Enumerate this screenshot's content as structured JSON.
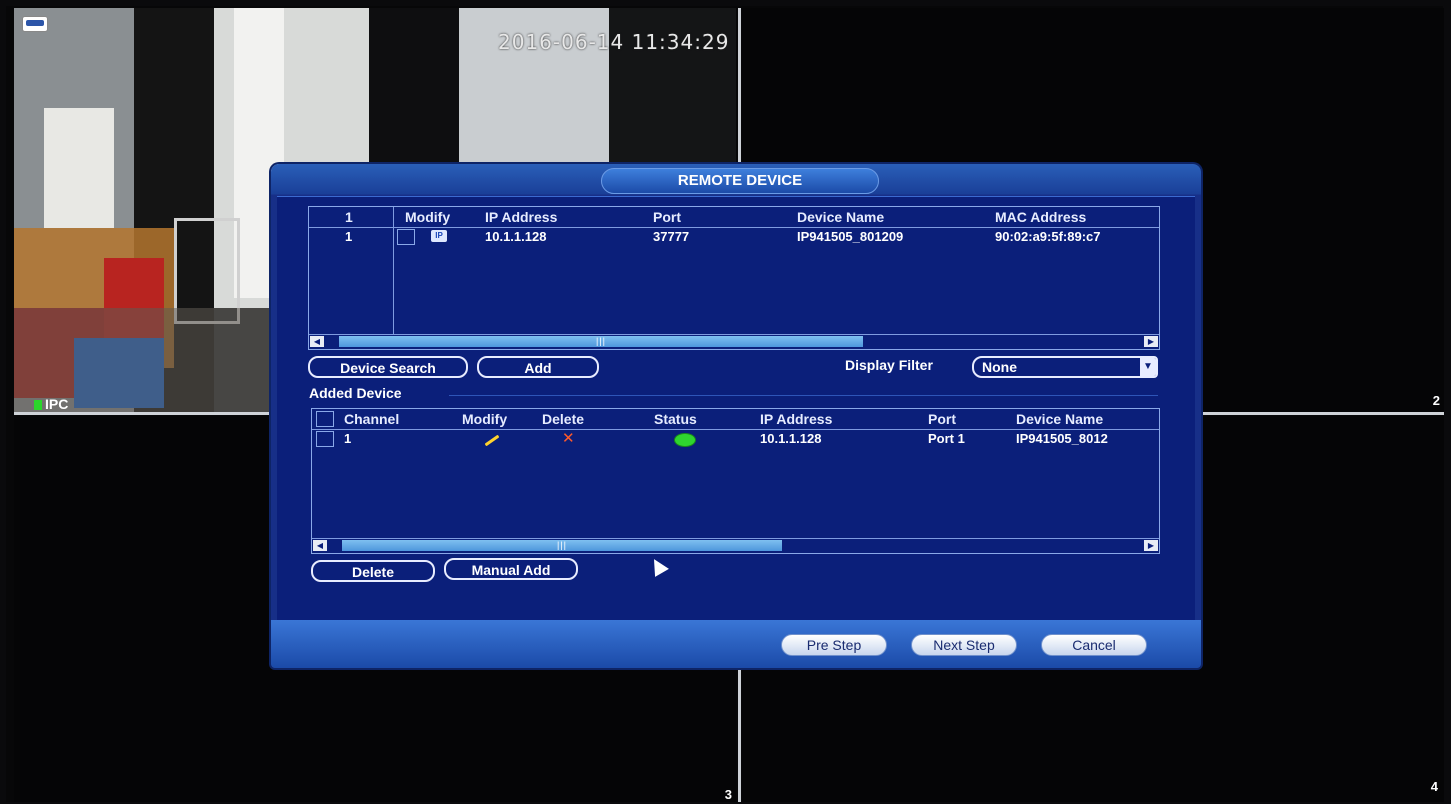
{
  "video": {
    "timestamp": "2016-06-14 11:34:29",
    "cam1_label": "IPC",
    "tile_numbers": [
      "2",
      "3",
      "4"
    ]
  },
  "dialog": {
    "title": "REMOTE DEVICE",
    "search_table": {
      "headers": [
        "1",
        "Modify",
        "IP Address",
        "Port",
        "Device Name",
        "MAC Address"
      ],
      "rows": [
        {
          "index": "1",
          "ip": "10.1.1.128",
          "port": "37777",
          "device_name": "IP941505_801209",
          "mac": "90:02:a9:5f:89:c7"
        }
      ]
    },
    "buttons": {
      "device_search": "Device Search",
      "add": "Add",
      "delete": "Delete",
      "manual_add": "Manual Add"
    },
    "display_filter": {
      "label": "Display Filter",
      "value": "None"
    },
    "added_section_title": "Added Device",
    "added_table": {
      "headers": [
        "Channel",
        "Modify",
        "Delete",
        "Status",
        "IP Address",
        "Port",
        "Device Name"
      ],
      "rows": [
        {
          "channel": "1",
          "ip": "10.1.1.128",
          "port": "Port 1",
          "device_name": "IP941505_8012"
        }
      ]
    },
    "footer": {
      "pre_step": "Pre Step",
      "next_step": "Next Step",
      "cancel": "Cancel"
    },
    "colors": {
      "dialog_bg": "#0b1f7a",
      "status_online": "#2fd62f",
      "modify_icon": "#ffd22e",
      "delete_icon": "#ff5a2a"
    }
  }
}
